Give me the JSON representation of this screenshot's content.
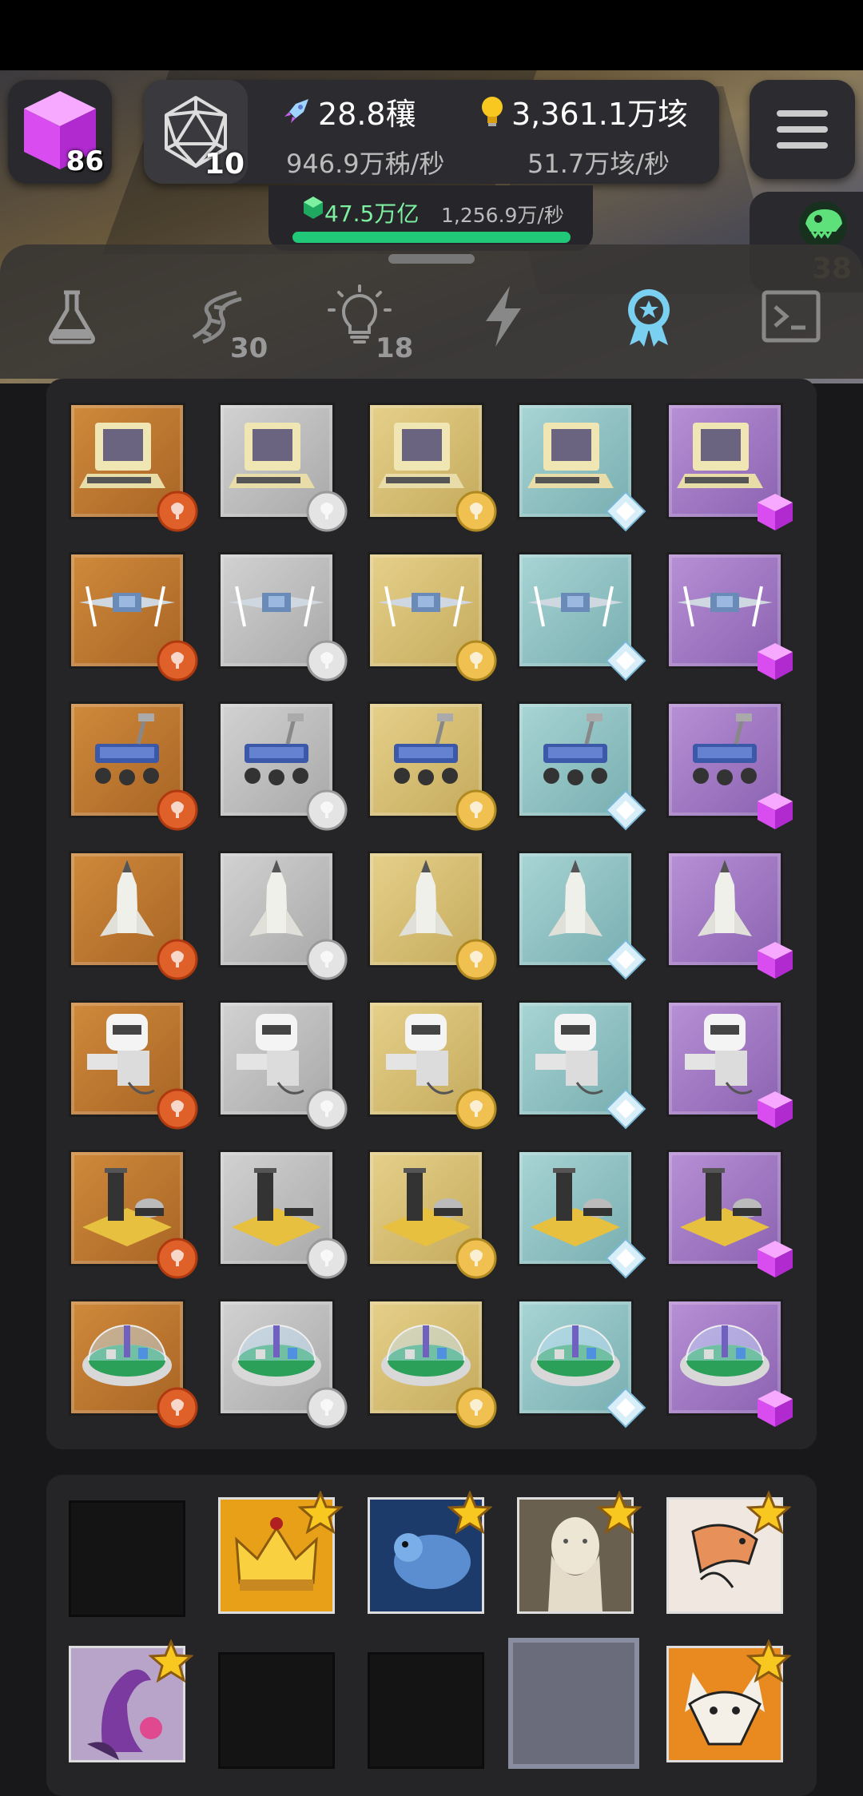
{
  "hud": {
    "cube_count": "86",
    "dice_count": "10",
    "resource1": {
      "value": "28.8穰",
      "rate": "946.9万秭/秒"
    },
    "resource2": {
      "value": "3,361.1万垓",
      "rate": "51.7万垓/秒"
    },
    "gem": {
      "value": "47.5万亿",
      "rate": "1,256.9万/秒",
      "progress": 1.0
    },
    "dino_count": "38"
  },
  "tabs": [
    {
      "name": "flask",
      "badge": ""
    },
    {
      "name": "dna",
      "badge": "30"
    },
    {
      "name": "idea",
      "badge": "18"
    },
    {
      "name": "lightning",
      "badge": ""
    },
    {
      "name": "award",
      "badge": "",
      "active": true
    },
    {
      "name": "terminal",
      "badge": ""
    }
  ],
  "tiers": [
    "bronze",
    "silver",
    "gold",
    "diamond",
    "cube"
  ],
  "items": [
    "computer",
    "drone",
    "rover",
    "space-shuttle",
    "robot",
    "power-station",
    "dome-city"
  ],
  "achievements": [
    {
      "name": "crown",
      "starred": true,
      "filled": true
    },
    {
      "name": "blue-creature",
      "starred": true,
      "filled": true
    },
    {
      "name": "darwin-statue",
      "starred": true,
      "filled": true
    },
    {
      "name": "trex-reading",
      "starred": true,
      "filled": true
    },
    {
      "name": "dinosaur-flower",
      "starred": true,
      "filled": true
    },
    {
      "name": "fox",
      "starred": true,
      "filled": true
    }
  ],
  "colors": {
    "accent": "#20c878",
    "active_tab": "#7ad0f0"
  }
}
